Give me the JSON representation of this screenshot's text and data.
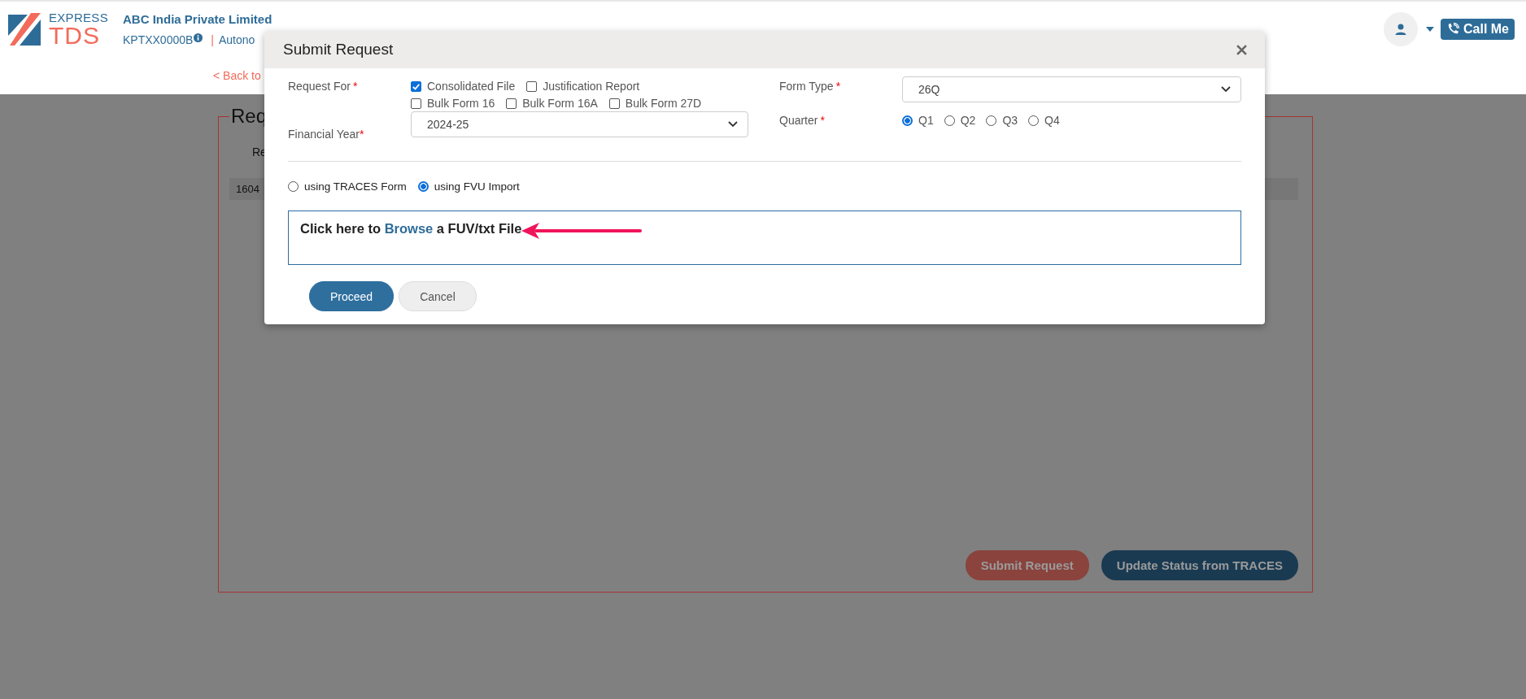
{
  "header": {
    "logo_top": "EXPRESS",
    "logo_bottom": "TDS",
    "company": "ABC India Private Limited",
    "tan": "KPTXX0000B",
    "separator": "|",
    "section": "Autono",
    "call_button": "Call Me"
  },
  "subbar": {
    "back_link": "< Back to"
  },
  "page": {
    "heading": "Req",
    "label": "Re",
    "row_cell": "1604",
    "buttons": [
      {
        "label": "Submit Request",
        "kind": "danger"
      },
      {
        "label": "Update Status from TRACES",
        "kind": "primary"
      }
    ]
  },
  "modal": {
    "title": "Submit Request",
    "request_for": {
      "label": "Request For",
      "mark": "*",
      "rows": [
        [
          {
            "label": "Consolidated File",
            "checked": true
          },
          {
            "label": "Justification Report",
            "checked": false
          }
        ],
        [
          {
            "label": "Bulk Form 16",
            "checked": false
          },
          {
            "label": "Bulk Form 16A",
            "checked": false
          },
          {
            "label": "Bulk Form 27D",
            "checked": false
          }
        ]
      ]
    },
    "financial_year": {
      "label": "Financial Year",
      "mark": "*",
      "value": "2024-25"
    },
    "form_type": {
      "label": "Form Type",
      "mark": "*",
      "value": "26Q"
    },
    "quarter": {
      "label": "Quarter",
      "mark": "*",
      "options": [
        {
          "label": "Q1",
          "selected": true
        },
        {
          "label": "Q2",
          "selected": false
        },
        {
          "label": "Q3",
          "selected": false
        },
        {
          "label": "Q4",
          "selected": false
        }
      ]
    },
    "methods": [
      {
        "label": "using TRACES Form",
        "selected": false
      },
      {
        "label": "using FVU Import",
        "selected": true
      }
    ],
    "upload": {
      "before": "Click here to",
      "link": "Browse",
      "after": "a FUV/txt File"
    },
    "buttons": [
      {
        "label": "Proceed",
        "kind": "primary"
      },
      {
        "label": "Cancel",
        "kind": "secondary"
      }
    ]
  }
}
